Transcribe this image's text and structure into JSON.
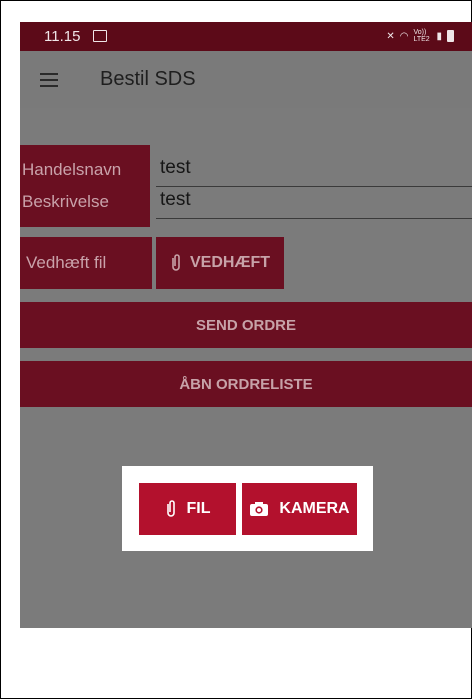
{
  "status_bar": {
    "time": "11.15",
    "icons": [
      "image-icon",
      "mute-icon",
      "wifi-icon",
      "volte-icon",
      "signal-icon",
      "battery-icon"
    ],
    "volte_text": "Vo)) LTE2"
  },
  "app_bar": {
    "title": "Bestil SDS",
    "menu_icon": "hamburger-menu-icon"
  },
  "form": {
    "handelsnavn_label": "Handelsnavn",
    "handelsnavn_value": "test",
    "beskrivelse_label": "Beskrivelse",
    "beskrivelse_value": "test",
    "vedhaeft_label": "Vedhæft fil",
    "vedhaeft_button": "VEDHÆFT"
  },
  "actions": {
    "send_order": "SEND ORDRE",
    "open_order_list": "ÅBN ORDRELISTE"
  },
  "picker_dialog": {
    "file_button": "FIL",
    "camera_button": "KAMERA"
  },
  "colors": {
    "accent": "#6a0f21",
    "dialog_button": "#b3112d",
    "overlay": "#7b7b7b"
  }
}
